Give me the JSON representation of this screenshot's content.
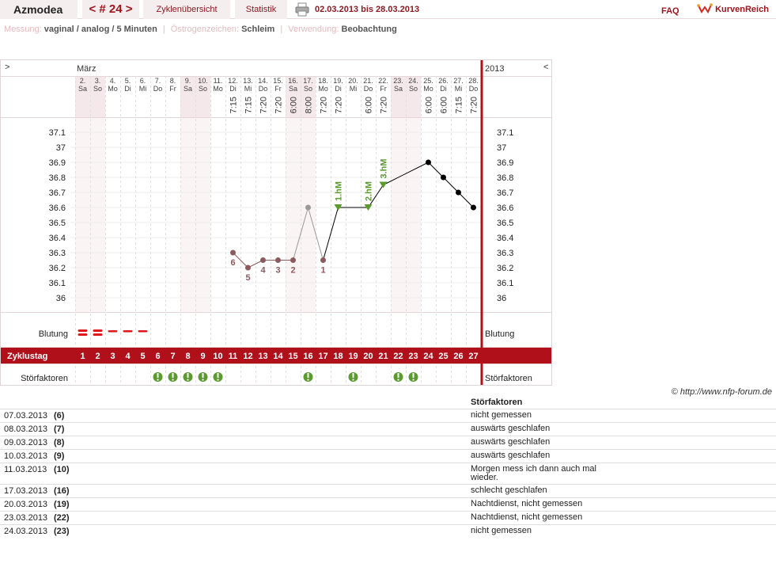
{
  "header": {
    "user": "Azmodea",
    "cycle_nav": "< # 24 >",
    "tab_overview": "Zyklenübersicht",
    "tab_stats": "Statistik",
    "date_range": "02.03.2013 bis 28.03.2013",
    "faq": "FAQ",
    "logo": "KurvenReich"
  },
  "info": {
    "measurement_label": "Messung:",
    "measurement_value": "vaginal / analog / 5 Minuten",
    "estrogen_label": "Östrogenzeichen:",
    "estrogen_value": "Schleim",
    "usage_label": "Verwendung:",
    "usage_value": "Beobachtung"
  },
  "chart": {
    "nav_left": ">",
    "nav_right": "<",
    "month": "März",
    "year": "2013",
    "bleeding_label": "Blutung",
    "cycle_day_label": "Zyklustag",
    "factor_label": "Störfaktoren",
    "colors": {
      "accent": "#b0101a",
      "weekend": "#f5e8ea",
      "curve": "#000000",
      "excluded": "#8a5a5e",
      "marker_green": "#5a9a2e",
      "bleeding": "#e0181e"
    }
  },
  "chart_data": {
    "type": "line",
    "ylim": [
      36.0,
      37.1
    ],
    "yticks": [
      "37.1",
      "37",
      "36.9",
      "36.8",
      "36.7",
      "36.6",
      "36.5",
      "36.4",
      "36.3",
      "36.2",
      "36.1",
      "36"
    ],
    "days": [
      {
        "date": "2.",
        "wd": "Sa",
        "cd": "1",
        "time": "",
        "temp": null,
        "weekend": true,
        "bleed": 2,
        "factor": false
      },
      {
        "date": "3.",
        "wd": "So",
        "cd": "2",
        "time": "",
        "temp": null,
        "weekend": true,
        "bleed": 2,
        "factor": false
      },
      {
        "date": "4.",
        "wd": "Mo",
        "cd": "3",
        "time": "",
        "temp": null,
        "weekend": false,
        "bleed": 1,
        "factor": false
      },
      {
        "date": "5.",
        "wd": "Di",
        "cd": "4",
        "time": "",
        "temp": null,
        "weekend": false,
        "bleed": 1,
        "factor": false
      },
      {
        "date": "6.",
        "wd": "Mi",
        "cd": "5",
        "time": "",
        "temp": null,
        "weekend": false,
        "bleed": 1,
        "factor": false
      },
      {
        "date": "7.",
        "wd": "Do",
        "cd": "6",
        "time": "",
        "temp": null,
        "weekend": false,
        "bleed": 0,
        "factor": true
      },
      {
        "date": "8.",
        "wd": "Fr",
        "cd": "7",
        "time": "",
        "temp": null,
        "weekend": false,
        "bleed": 0,
        "factor": true
      },
      {
        "date": "9.",
        "wd": "Sa",
        "cd": "8",
        "time": "",
        "temp": null,
        "weekend": true,
        "bleed": 0,
        "factor": true
      },
      {
        "date": "10.",
        "wd": "So",
        "cd": "9",
        "time": "",
        "temp": null,
        "weekend": true,
        "bleed": 0,
        "factor": true
      },
      {
        "date": "11.",
        "wd": "Mo",
        "cd": "10",
        "time": "",
        "temp": null,
        "weekend": false,
        "bleed": 0,
        "factor": true
      },
      {
        "date": "12.",
        "wd": "Di",
        "cd": "11",
        "time": "7:15",
        "temp": 36.3,
        "weekend": false,
        "bleed": 0,
        "factor": false,
        "mark": "6"
      },
      {
        "date": "13.",
        "wd": "Mi",
        "cd": "12",
        "time": "7:15",
        "temp": 36.2,
        "weekend": false,
        "bleed": 0,
        "factor": false,
        "mark": "5"
      },
      {
        "date": "14.",
        "wd": "Do",
        "cd": "13",
        "time": "7:20",
        "temp": 36.25,
        "weekend": false,
        "bleed": 0,
        "factor": false,
        "mark": "4"
      },
      {
        "date": "15.",
        "wd": "Fr",
        "cd": "14",
        "time": "7:20",
        "temp": 36.25,
        "weekend": false,
        "bleed": 0,
        "factor": false,
        "mark": "3"
      },
      {
        "date": "16.",
        "wd": "Sa",
        "cd": "15",
        "time": "6:00",
        "temp": 36.25,
        "weekend": true,
        "bleed": 0,
        "factor": false,
        "mark": "2"
      },
      {
        "date": "17.",
        "wd": "So",
        "cd": "16",
        "time": "8:00",
        "temp": 36.6,
        "weekend": true,
        "bleed": 0,
        "factor": true,
        "excluded": true
      },
      {
        "date": "18.",
        "wd": "Mo",
        "cd": "17",
        "time": "7:20",
        "temp": 36.25,
        "weekend": false,
        "bleed": 0,
        "factor": false,
        "mark": "1"
      },
      {
        "date": "19.",
        "wd": "Di",
        "cd": "18",
        "time": "7:20",
        "temp": 36.6,
        "weekend": false,
        "bleed": 0,
        "factor": false,
        "hm": "1.hM"
      },
      {
        "date": "20.",
        "wd": "Mi",
        "cd": "19",
        "time": "",
        "temp": null,
        "weekend": false,
        "bleed": 0,
        "factor": true
      },
      {
        "date": "21.",
        "wd": "Do",
        "cd": "20",
        "time": "6:00",
        "temp": 36.6,
        "weekend": false,
        "bleed": 0,
        "factor": false,
        "hm": "2.hM"
      },
      {
        "date": "22.",
        "wd": "Fr",
        "cd": "21",
        "time": "7:20",
        "temp": 36.75,
        "weekend": false,
        "bleed": 0,
        "factor": false,
        "hm": "3.hM"
      },
      {
        "date": "23.",
        "wd": "Sa",
        "cd": "22",
        "time": "",
        "temp": null,
        "weekend": true,
        "bleed": 0,
        "factor": true
      },
      {
        "date": "24.",
        "wd": "So",
        "cd": "23",
        "time": "",
        "temp": null,
        "weekend": true,
        "bleed": 0,
        "factor": true
      },
      {
        "date": "25.",
        "wd": "Mo",
        "cd": "24",
        "time": "6:00",
        "temp": 36.9,
        "weekend": false,
        "bleed": 0,
        "factor": false
      },
      {
        "date": "26.",
        "wd": "Di",
        "cd": "25",
        "time": "6:00",
        "temp": 36.8,
        "weekend": false,
        "bleed": 0,
        "factor": false
      },
      {
        "date": "27.",
        "wd": "Mi",
        "cd": "26",
        "time": "7:15",
        "temp": 36.7,
        "weekend": false,
        "bleed": 0,
        "factor": false
      },
      {
        "date": "28.",
        "wd": "Do",
        "cd": "27",
        "time": "7:20",
        "temp": 36.6,
        "weekend": false,
        "bleed": 0,
        "factor": false
      }
    ]
  },
  "copyright": "© http://www.nfp-forum.de",
  "factors_table": {
    "header": "Störfaktoren",
    "rows": [
      {
        "date": "07.03.2013",
        "cd": "(6)",
        "text": "nicht gemessen"
      },
      {
        "date": "08.03.2013",
        "cd": "(7)",
        "text": "auswärts geschlafen"
      },
      {
        "date": "09.03.2013",
        "cd": "(8)",
        "text": "auswärts geschlafen"
      },
      {
        "date": "10.03.2013",
        "cd": "(9)",
        "text": "auswärts geschlafen"
      },
      {
        "date": "11.03.2013",
        "cd": "(10)",
        "text": "Morgen mess ich dann auch mal wieder."
      },
      {
        "date": "17.03.2013",
        "cd": "(16)",
        "text": "schlecht geschlafen"
      },
      {
        "date": "20.03.2013",
        "cd": "(19)",
        "text": "Nachtdienst, nicht gemessen"
      },
      {
        "date": "23.03.2013",
        "cd": "(22)",
        "text": "Nachtdienst, nicht gemessen"
      },
      {
        "date": "24.03.2013",
        "cd": "(23)",
        "text": "nicht gemessen"
      }
    ]
  }
}
